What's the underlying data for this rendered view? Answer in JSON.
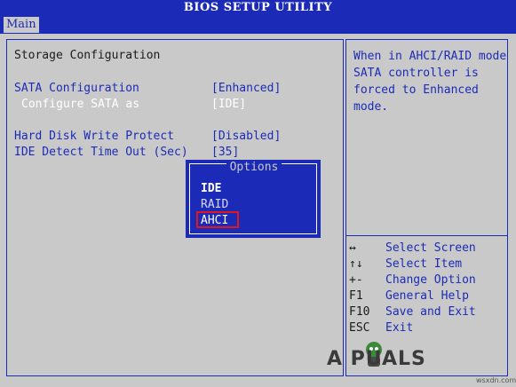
{
  "title": "BIOS SETUP UTILITY",
  "menu": {
    "active_tab": "Main"
  },
  "section_title": "Storage Configuration",
  "settings": [
    {
      "label": "SATA Configuration",
      "value": "[Enhanced]"
    },
    {
      "label": "Configure SATA as",
      "value": "[IDE]"
    },
    {
      "label": "Hard Disk Write Protect",
      "value": "[Disabled]"
    },
    {
      "label": "IDE Detect Time Out (Sec)",
      "value": "[35]"
    }
  ],
  "help_text": [
    "When in AHCI/RAID mode",
    "SATA controller is",
    "forced to Enhanced",
    "mode."
  ],
  "options_popup": {
    "title": "Options",
    "items": [
      "IDE",
      "RAID",
      "AHCI"
    ],
    "selected": "IDE",
    "highlighted": "AHCI"
  },
  "key_help": [
    {
      "key": "↔",
      "desc": "Select Screen"
    },
    {
      "key": "↑↓",
      "desc": "Select Item"
    },
    {
      "key": "+-",
      "desc": "Change Option"
    },
    {
      "key": "F1",
      "desc": "General Help"
    },
    {
      "key": "F10",
      "desc": "Save and Exit"
    },
    {
      "key": "ESC",
      "desc": "Exit"
    }
  ],
  "logo": "A PUALS",
  "watermark": "wsxdn.com",
  "colors": {
    "bios_blue": "#1c2bb7",
    "bios_gray": "#c9c9c9",
    "highlight_red": "#e01818"
  }
}
